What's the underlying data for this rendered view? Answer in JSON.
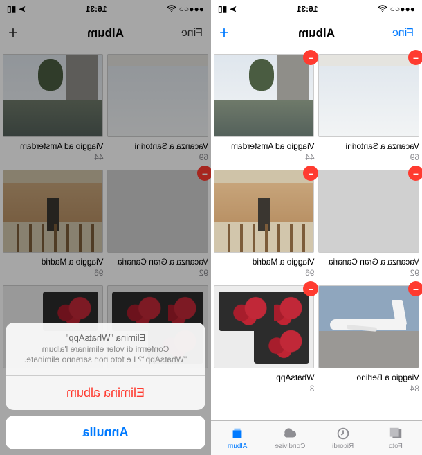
{
  "status": {
    "time": "16:31"
  },
  "nav": {
    "edit": "Fine",
    "title": "Album",
    "add": "+"
  },
  "albums": [
    {
      "title": "Vacanza a Santorini",
      "count": "69"
    },
    {
      "title": "Viaggio ad Amsterdam",
      "count": "44"
    },
    {
      "title": "Vacanza a Gran Canaria",
      "count": "92"
    },
    {
      "title": "Viaggio a Madrid",
      "count": "96"
    },
    {
      "title": "Viaggio a Berlino",
      "count": "84"
    },
    {
      "title": "WhatsApp",
      "count": "3"
    }
  ],
  "tabs": {
    "foto": "Foto",
    "ricordi": "Ricordi",
    "condivise": "Condivise",
    "album": "Album"
  },
  "sheet": {
    "title": "Elimina \"WhatsApp\"",
    "message": "Confermi di voler eliminare l'album \"WhatsApp\"? Le foto non saranno eliminate.",
    "destructive": "Elimina album",
    "cancel": "Annulla"
  }
}
